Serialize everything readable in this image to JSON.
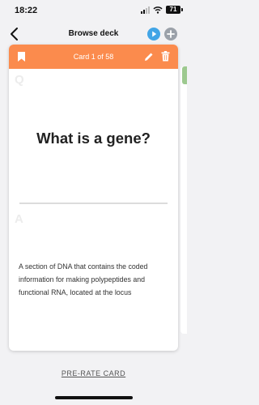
{
  "status_bar": {
    "time": "18:22",
    "battery": "71"
  },
  "nav": {
    "title": "Browse deck"
  },
  "card": {
    "counter": "Card 1 of 58",
    "question_marker": "Q",
    "answer_marker": "A",
    "question": "What is a gene?",
    "answer": "A section of DNA that contains the coded information for making polypeptides and functional RNA, located at the locus"
  },
  "actions": {
    "prerate_label": "PRE-RATE CARD"
  },
  "colors": {
    "header": "#fb8b4d",
    "play_button": "#42a5e6",
    "add_button": "#9ba1a9",
    "stack_accent": "#9dc98f"
  },
  "icons": [
    "back-chevron-icon",
    "play-icon",
    "plus-icon",
    "bookmark-icon",
    "pencil-icon",
    "trash-icon",
    "signal-icon",
    "wifi-icon",
    "battery-icon"
  ]
}
